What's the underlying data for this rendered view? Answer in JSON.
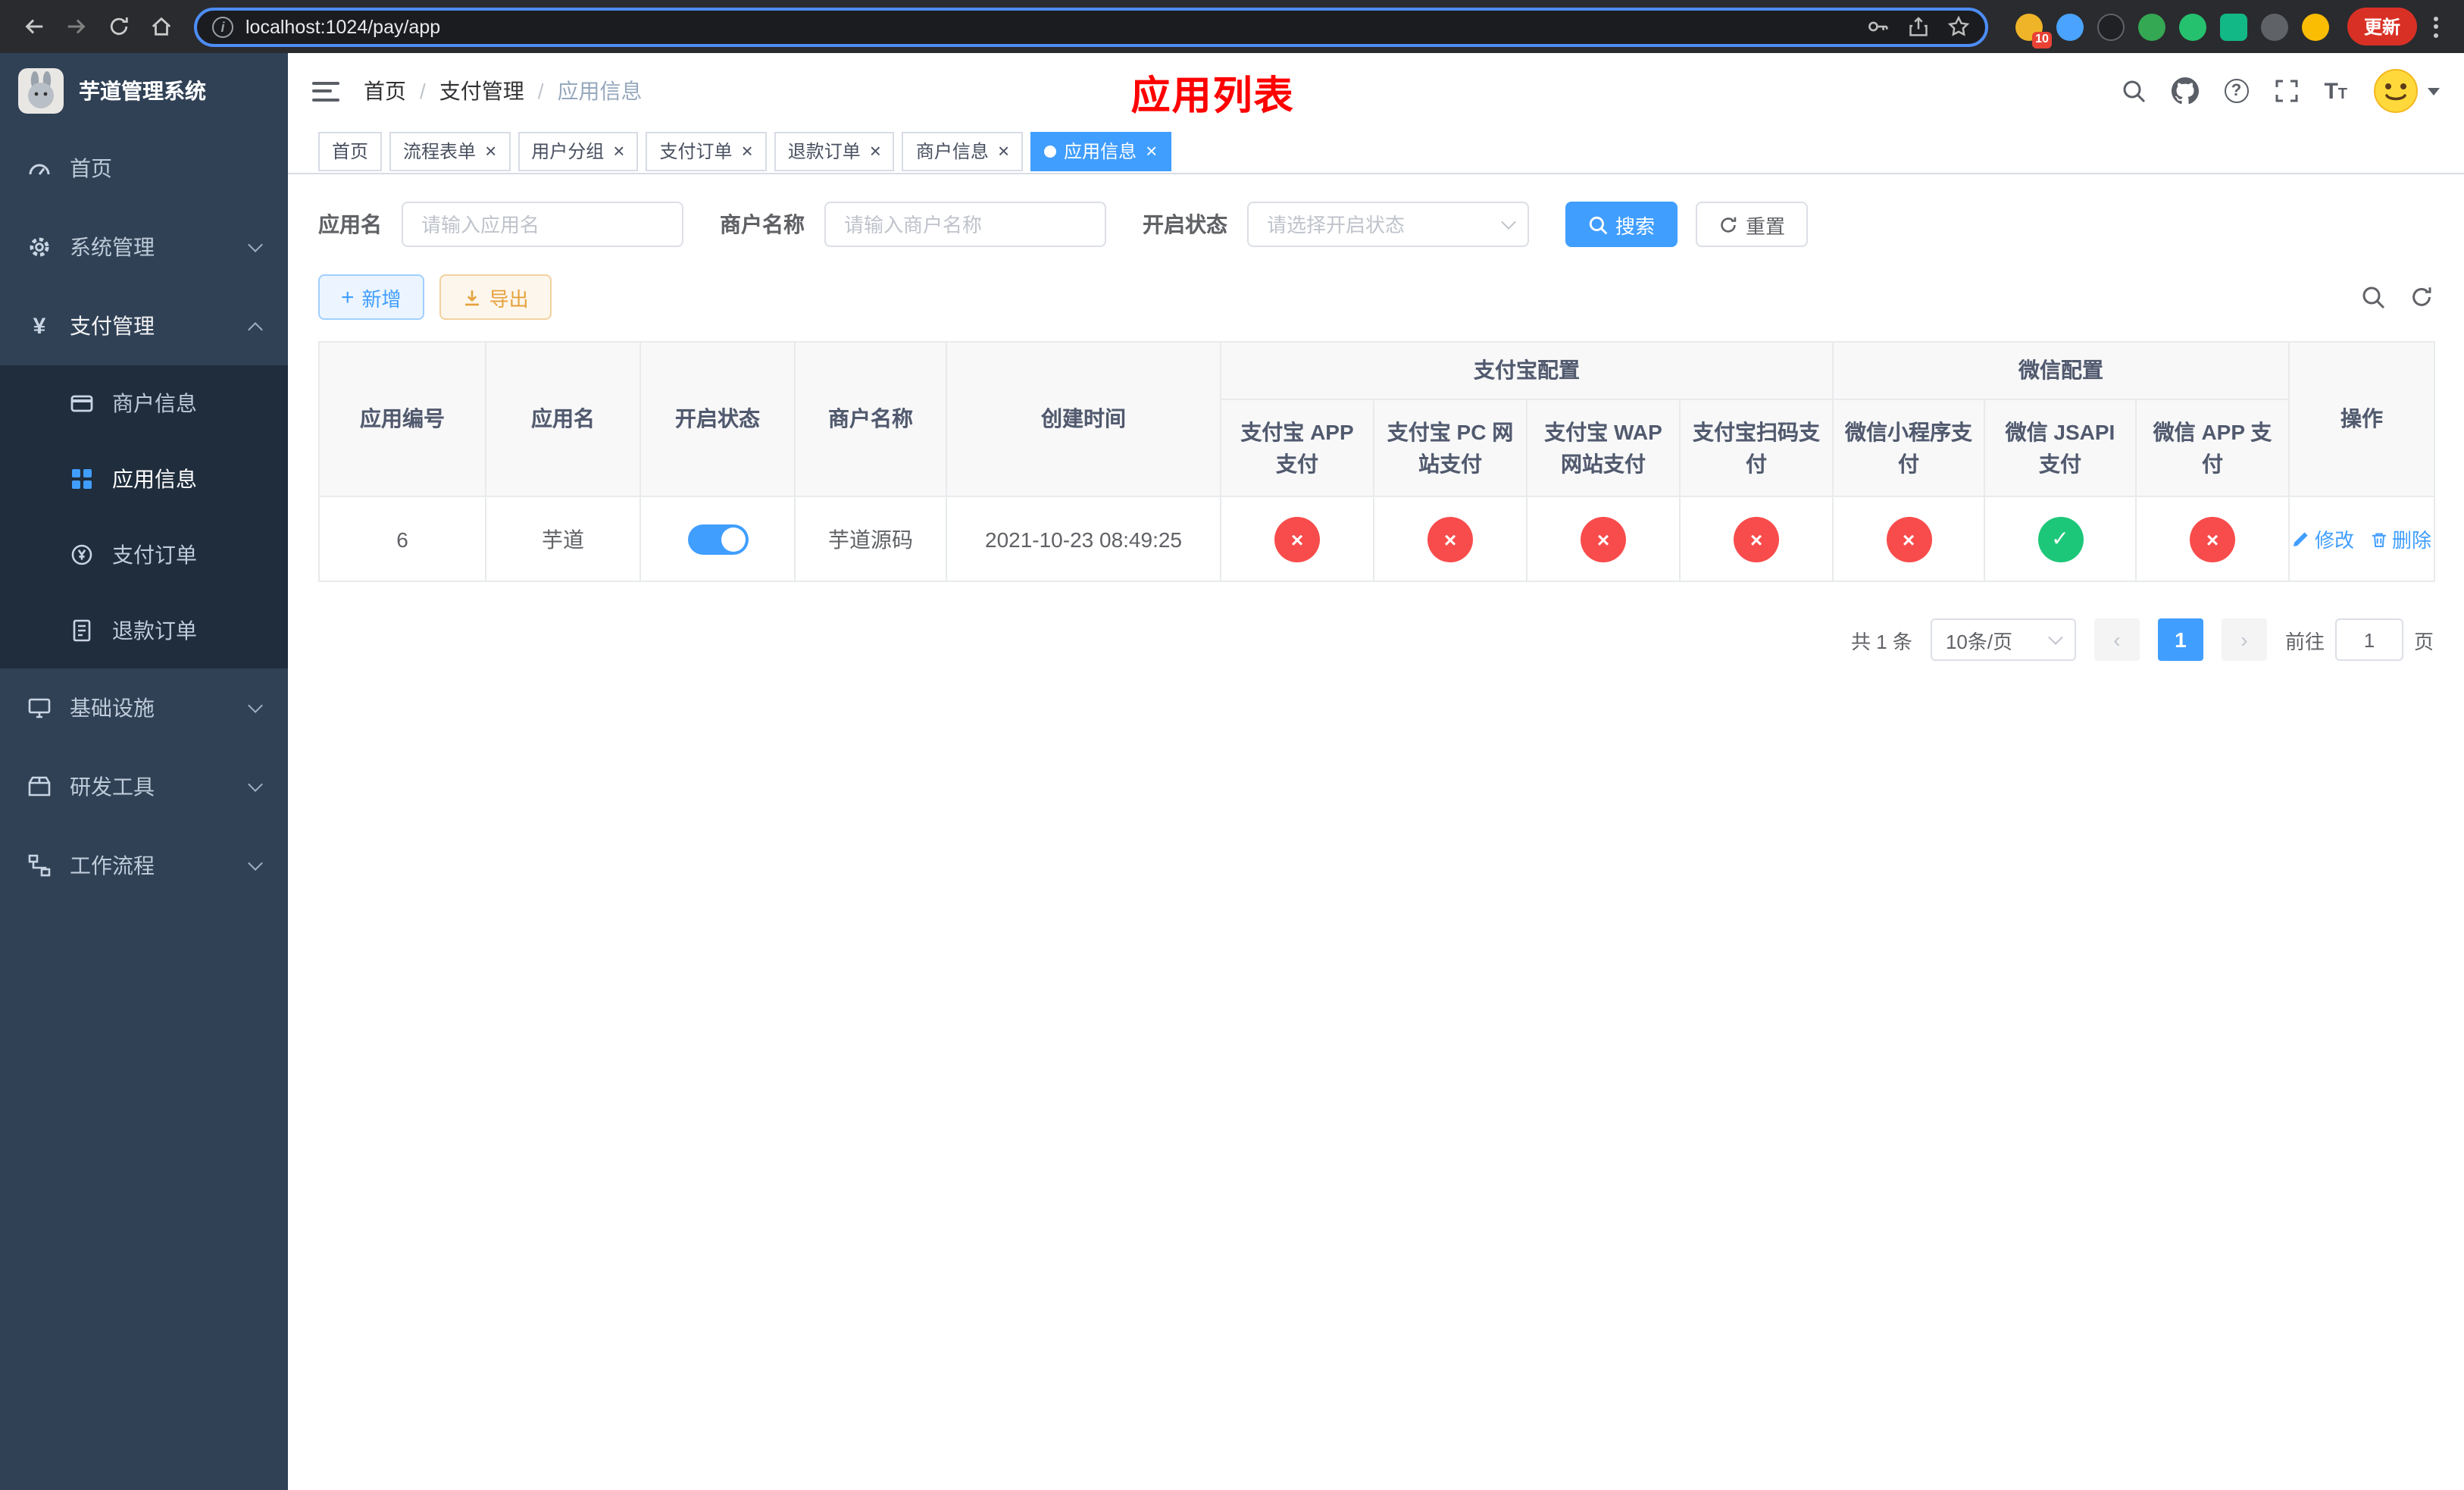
{
  "browser": {
    "url": "localhost:1024/pay/app",
    "update_button": "更新",
    "extension_badge": "10"
  },
  "app": {
    "title": "芋道管理系统",
    "page_title": "应用列表"
  },
  "sidebar": {
    "menu": [
      {
        "label": "首页"
      },
      {
        "label": "系统管理"
      },
      {
        "label": "支付管理"
      },
      {
        "label": "基础设施"
      },
      {
        "label": "研发工具"
      },
      {
        "label": "工作流程"
      }
    ],
    "submenu": [
      {
        "label": "商户信息"
      },
      {
        "label": "应用信息"
      },
      {
        "label": "支付订单"
      },
      {
        "label": "退款订单"
      }
    ]
  },
  "breadcrumb": [
    "首页",
    "支付管理",
    "应用信息"
  ],
  "tabs": [
    {
      "label": "首页"
    },
    {
      "label": "流程表单"
    },
    {
      "label": "用户分组"
    },
    {
      "label": "支付订单"
    },
    {
      "label": "退款订单"
    },
    {
      "label": "商户信息"
    },
    {
      "label": "应用信息"
    }
  ],
  "filters": {
    "app_name_label": "应用名",
    "app_name_placeholder": "请输入应用名",
    "merchant_label": "商户名称",
    "merchant_placeholder": "请输入商户名称",
    "status_label": "开启状态",
    "status_placeholder": "请选择开启状态",
    "search_button": "搜索",
    "reset_button": "重置"
  },
  "toolbar": {
    "add_button": "新增",
    "export_button": "导出"
  },
  "table": {
    "col_id": "应用编号",
    "col_name": "应用名",
    "col_status": "开启状态",
    "col_merchant": "商户名称",
    "col_created": "创建时间",
    "group_alipay": "支付宝配置",
    "group_wechat": "微信配置",
    "col_alipay_app": "支付宝 APP 支付",
    "col_alipay_pc": "支付宝 PC 网站支付",
    "col_alipay_wap": "支付宝 WAP 网站支付",
    "col_alipay_qr": "支付宝扫码支付",
    "col_wx_lite": "微信小程序支付",
    "col_wx_jsapi": "微信 JSAPI 支付",
    "col_wx_app": "微信 APP 支付",
    "col_actions": "操作",
    "row": {
      "id": "6",
      "name": "芋道",
      "enabled": true,
      "merchant": "芋道源码",
      "created": "2021-10-23 08:49:25",
      "alipay_app": false,
      "alipay_pc": false,
      "alipay_wap": false,
      "alipay_qr": false,
      "wx_lite": false,
      "wx_jsapi": true,
      "wx_app": false,
      "edit": "修改",
      "delete": "删除"
    }
  },
  "pagination": {
    "total": "共 1 条",
    "page_size": "10条/页",
    "prev": "‹",
    "current_page": "1",
    "next": "›",
    "goto_label": "前往",
    "goto_value": "1",
    "page_unit": "页"
  },
  "colors": {
    "accent": "#409eff",
    "danger_circle": "#f84c4c",
    "success_circle": "#1dc779",
    "title_red": "#ff0000",
    "sidebar_bg": "#304156",
    "submenu_bg": "#1f2d3d",
    "update_button_bg": "#d93025"
  }
}
